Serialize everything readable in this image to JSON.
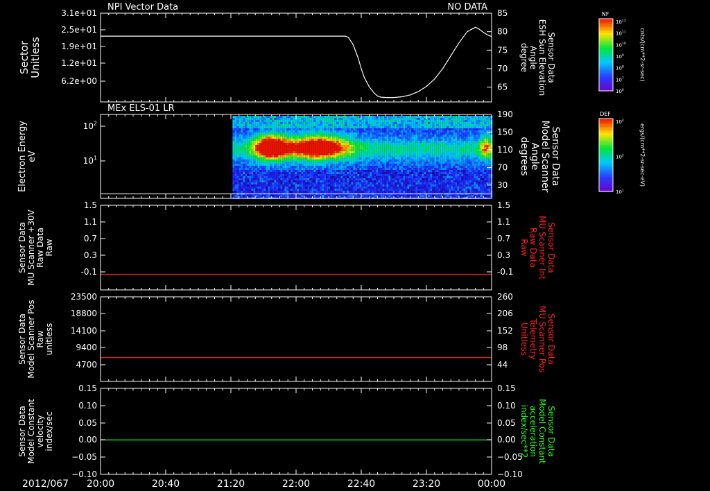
{
  "chart_data": [
    {
      "type": "line",
      "title": "NPI Vector Data",
      "status": "NO DATA",
      "ylabel": [
        "Sector",
        "Unitless"
      ],
      "yticks": [
        "3.1e+01",
        "2.5e+01",
        "1.9e+01",
        "1.2e+01",
        "6.2e+00"
      ],
      "ylim": [
        0,
        31
      ],
      "y2label": [
        "Sensor Data",
        "ESH Sun Elevation",
        "Angle",
        "degree"
      ],
      "y2ticks": [
        85,
        80,
        75,
        70,
        65
      ],
      "y2lim": [
        61,
        85
      ],
      "series": [
        {
          "color": "#ffffff",
          "axis": "right",
          "x": [
            0,
            10,
            20,
            30,
            40,
            50,
            60,
            70,
            80,
            100,
            120,
            140,
            150,
            152,
            155,
            158,
            160,
            162,
            165,
            168,
            170,
            172,
            175,
            178,
            180,
            185,
            190,
            195,
            200,
            205,
            210,
            215,
            220,
            225,
            230,
            232,
            235,
            238,
            240
          ],
          "y": [
            78.8,
            78.8,
            78.8,
            78.8,
            78.8,
            78.8,
            78.8,
            78.8,
            78.8,
            78.8,
            78.8,
            78.8,
            78.8,
            78.5,
            76.5,
            73,
            70,
            67.5,
            65,
            63.4,
            62.6,
            62.3,
            62.2,
            62.2,
            62.2,
            62.4,
            62.9,
            63.8,
            65.2,
            67.2,
            70,
            73.5,
            77,
            80,
            81.2,
            80.8,
            79.8,
            79,
            78.7
          ]
        }
      ]
    },
    {
      "type": "heatmap",
      "title": "MEx ELS-01 LR",
      "ylabel": [
        "Electron Energy",
        "eV"
      ],
      "yticks": [
        "10^2",
        "10^1"
      ],
      "ylim": [
        1,
        200
      ],
      "y2label": [
        "Sensor Data",
        "Model Scanner",
        "Angle",
        "degrees"
      ],
      "y2ticks": [
        190,
        150,
        110,
        70,
        30
      ],
      "y2lim": [
        0,
        190
      ],
      "data_start_x": 81,
      "baseline_y2": 10,
      "hotspots": [
        {
          "x": 104,
          "w": 10,
          "energy": 50,
          "peak": 1.0
        },
        {
          "x": 133,
          "w": 18,
          "energy": 55,
          "peak": 0.9
        },
        {
          "x": 236,
          "w": 4,
          "energy": 30,
          "peak": 0.45
        }
      ]
    },
    {
      "type": "line",
      "ylabel": [
        "Sensor Data",
        "MU Scanner +30V",
        "Raw Data",
        "Raw"
      ],
      "yticks": [
        1.5,
        1.1,
        0.7,
        0.3,
        -0.1
      ],
      "ylim": [
        -0.4,
        1.5
      ],
      "y2label": [
        "Sensor Data",
        "MU Scanner Int",
        "Raw Data",
        "Raw"
      ],
      "y2ticks": [
        1.5,
        1.1,
        0.7,
        0.3,
        -0.1
      ],
      "y2lim": [
        -0.4,
        1.5
      ],
      "y2color": "#ff2020",
      "series": [
        {
          "color": "#ff2020",
          "axis": "left",
          "x": [
            0,
            240
          ],
          "y": [
            -0.05,
            -0.05
          ]
        }
      ]
    },
    {
      "type": "line",
      "ylabel": [
        "Sensor Data",
        "Model Scanner Pos",
        "Raw",
        "unitless"
      ],
      "yticks": [
        23500,
        18800,
        14100,
        9400,
        4700
      ],
      "ylim": [
        0,
        23500
      ],
      "y2label": [
        "Sensor Data",
        "MU Scanner Pos",
        "Telemetry",
        "Unitless"
      ],
      "y2ticks": [
        260,
        206,
        152,
        98,
        44
      ],
      "y2lim": [
        0,
        260
      ],
      "y2color": "#ff2020",
      "series": [
        {
          "color": "#ff2020",
          "axis": "left",
          "x": [
            0,
            240
          ],
          "y": [
            6600,
            6600
          ]
        }
      ]
    },
    {
      "type": "line",
      "ylabel": [
        "Sensor Data",
        "Model Constant",
        "velocity",
        "index/sec"
      ],
      "yticks": [
        "0.15",
        "0.10",
        "0.05",
        "0.00",
        "−0.05",
        "−0.10"
      ],
      "ylim": [
        -0.1,
        0.15
      ],
      "y2label": [
        "Sensor Data",
        "Model Constant",
        "acceleration",
        "index/sec**2"
      ],
      "y2ticks": [
        "0.15",
        "0.10",
        "0.05",
        "0.00",
        "−0.05",
        "−0.10"
      ],
      "y2lim": [
        -0.1,
        0.15
      ],
      "y2color": "#20ff20",
      "series": [
        {
          "color": "#20ff20",
          "axis": "left",
          "x": [
            0,
            240
          ],
          "y": [
            0,
            0
          ]
        }
      ]
    }
  ],
  "time_axis": {
    "date": "2012/067",
    "ticks": [
      "20:00",
      "20:40",
      "21:20",
      "22:00",
      "22:40",
      "23:20",
      "00:00"
    ],
    "tick_minutes": [
      0,
      40,
      80,
      120,
      160,
      200,
      240
    ],
    "range_minutes": [
      0,
      240
    ]
  },
  "colorbars": [
    {
      "label": "NF",
      "unit": "cnts/(cm**2-sr-sec)",
      "ticks": [
        "10^12",
        "10^11",
        "10^10",
        "10^9",
        "10^8",
        "10^7",
        "10^6"
      ]
    },
    {
      "label": "DEF",
      "unit": "ergs/(cm**2-sr-sec-eV)",
      "ticks": [
        "10^4",
        "10^2",
        "10^1"
      ]
    }
  ],
  "colors": {
    "background": "#000000",
    "axis": "#ffffff",
    "red_trace": "#ff2020",
    "green_trace": "#20ff20"
  }
}
